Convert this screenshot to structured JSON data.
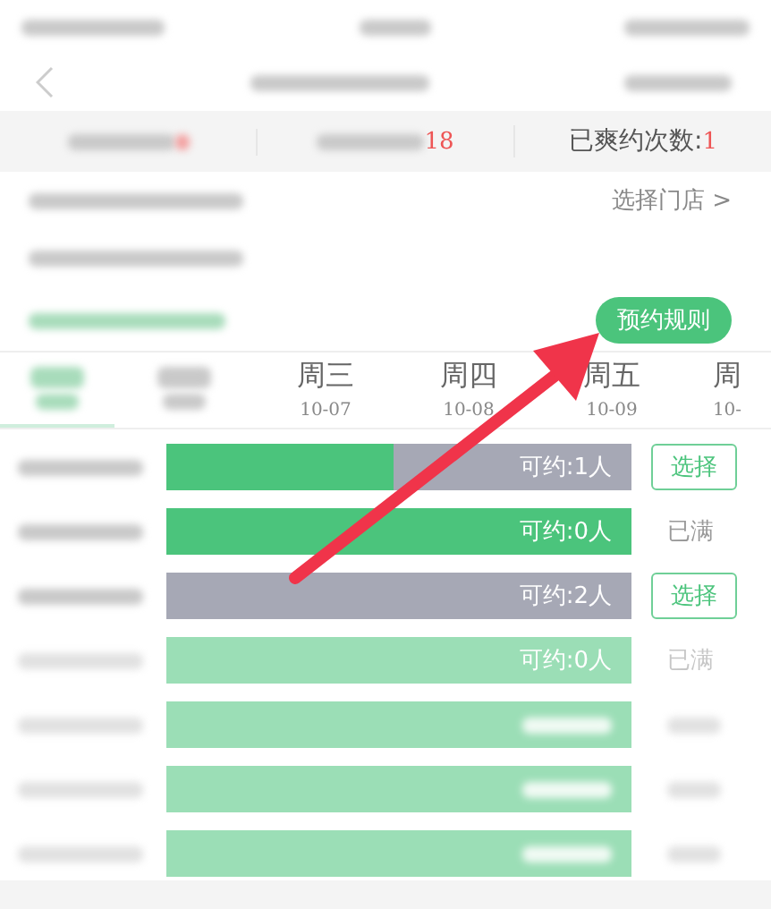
{
  "stats": [
    {
      "kind": "blurred"
    },
    {
      "kind": "value",
      "value": "18"
    },
    {
      "kind": "labeled",
      "label": "已爽约次数:",
      "value": "1"
    }
  ],
  "store": {
    "link": "选择门店 >",
    "rules_button": "预约规则"
  },
  "days": [
    {
      "selected": true
    },
    {
      "selected": false
    },
    {
      "weekday": "周三",
      "date": "10-07",
      "selected": false
    },
    {
      "weekday": "周四",
      "date": "10-08",
      "selected": false
    },
    {
      "weekday": "周五",
      "date": "10-09",
      "selected": false
    },
    {
      "weekday": "周",
      "date": "10-",
      "selected": false
    }
  ],
  "slots": [
    {
      "level": 0.49,
      "reading": "可约:1人",
      "kind": "button",
      "action": "选择",
      "faded": false
    },
    {
      "level": 1,
      "reading": "可约:0人",
      "kind": "text",
      "action": "已满",
      "faded": false
    },
    {
      "level": 0,
      "reading": "可约:2人",
      "kind": "button",
      "action": "选择",
      "faded": false
    },
    {
      "level": 1,
      "reading": "可约:0人",
      "kind": "text",
      "action": "已满",
      "faded": true
    },
    {
      "level": 1,
      "kind": "text",
      "faded": true
    },
    {
      "level": 1,
      "kind": "text",
      "faded": true
    },
    {
      "level": 1,
      "kind": "text",
      "faded": true
    }
  ]
}
